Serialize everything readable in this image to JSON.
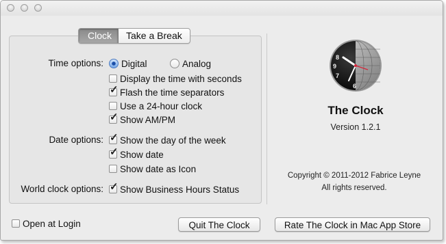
{
  "tabs": [
    "Clock",
    "Take a Break"
  ],
  "time_options": {
    "label": "Time options:",
    "radios": [
      {
        "label": "Digital",
        "selected": true
      },
      {
        "label": "Analog",
        "selected": false
      }
    ],
    "checks": [
      {
        "label": "Display the time with seconds",
        "checked": false
      },
      {
        "label": "Flash the time separators",
        "checked": true
      },
      {
        "label": "Use a 24-hour clock",
        "checked": false
      },
      {
        "label": "Show AM/PM",
        "checked": true
      }
    ]
  },
  "date_options": {
    "label": "Date options:",
    "checks": [
      {
        "label": "Show the day of the week",
        "checked": true
      },
      {
        "label": "Show date",
        "checked": true
      },
      {
        "label": "Show date as Icon",
        "checked": false
      }
    ]
  },
  "world_clock": {
    "label": "World clock options:",
    "checks": [
      {
        "label": "Show Business Hours Status",
        "checked": true
      }
    ]
  },
  "open_at_login": {
    "label": "Open at Login",
    "checked": false
  },
  "about": {
    "name": "The Clock",
    "version": "Version 1.2.1",
    "copyright": "Copyright © 2011-2012 Fabrice Leyne",
    "rights": "All rights reserved."
  },
  "buttons": {
    "quit": "Quit The Clock",
    "rate": "Rate The Clock in Mac App Store"
  },
  "icon_dial_numbers": [
    "8",
    "9",
    "7",
    "6"
  ]
}
